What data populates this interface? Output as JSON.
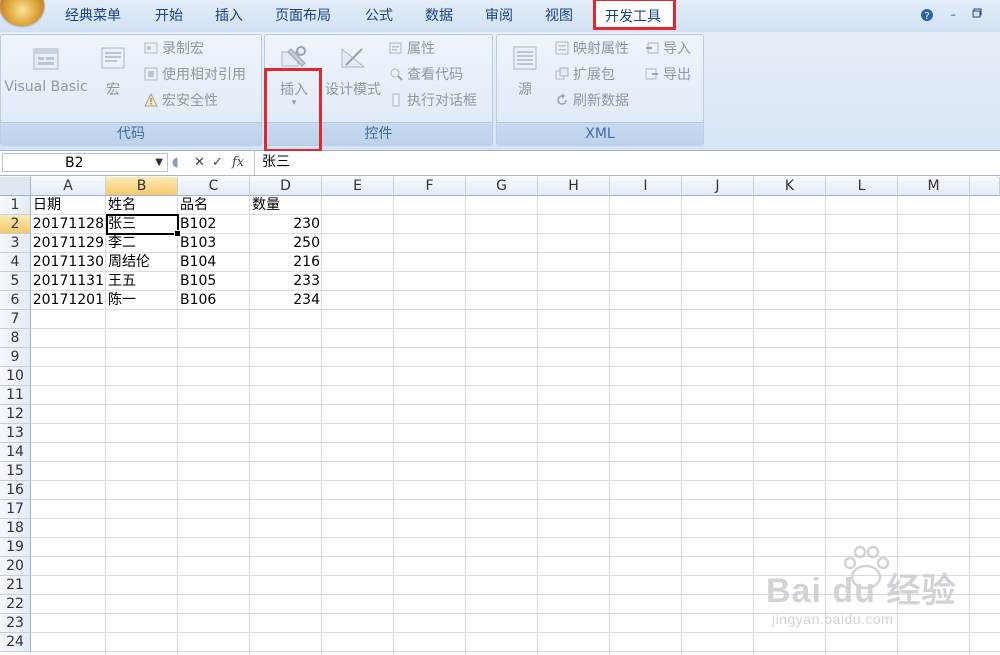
{
  "tabs": [
    {
      "label": "经典菜单"
    },
    {
      "label": "开始"
    },
    {
      "label": "插入"
    },
    {
      "label": "页面布局"
    },
    {
      "label": "公式"
    },
    {
      "label": "数据"
    },
    {
      "label": "审阅"
    },
    {
      "label": "视图"
    },
    {
      "label": "开发工具"
    }
  ],
  "ribbon": {
    "code": {
      "label": "代码",
      "visual_basic": "Visual Basic",
      "macro": "宏",
      "record_macro": "录制宏",
      "relative_ref": "使用相对引用",
      "macro_security": "宏安全性"
    },
    "controls": {
      "label": "控件",
      "insert": "插入",
      "design_mode": "设计模式",
      "properties": "属性",
      "view_code": "查看代码",
      "run_dialog": "执行对话框"
    },
    "xml": {
      "label": "XML",
      "source": "源",
      "map_properties": "映射属性",
      "expansion_packs": "扩展包",
      "refresh_data": "刷新数据",
      "import": "导入",
      "export": "导出"
    }
  },
  "formula_bar": {
    "name_box": "B2",
    "value": "张三"
  },
  "grid": {
    "columns": [
      "A",
      "B",
      "C",
      "D",
      "E",
      "F",
      "G",
      "H",
      "I",
      "J",
      "K",
      "L",
      "M"
    ],
    "rows": [
      "1",
      "2",
      "3",
      "4",
      "5",
      "6",
      "7",
      "8",
      "9",
      "10",
      "11",
      "12",
      "13",
      "14",
      "15",
      "16",
      "17",
      "18",
      "19",
      "20",
      "21",
      "22",
      "23",
      "24"
    ],
    "selected_cell": "B2",
    "header": [
      "日期",
      "姓名",
      "品名",
      "数量"
    ],
    "data": [
      [
        "20171128",
        "张三",
        "B102",
        "230"
      ],
      [
        "20171129",
        "李二",
        "B103",
        "250"
      ],
      [
        "20171130",
        "周结伦",
        "B104",
        "216"
      ],
      [
        "20171131",
        "王五",
        "B105",
        "233"
      ],
      [
        "20171201",
        "陈一",
        "B106",
        "234"
      ]
    ]
  },
  "watermark": {
    "line1": "Bai du 经验",
    "line2": "jingyan.baidu.com"
  },
  "colors": {
    "highlight": "#e0282e",
    "tab_text": "#15428b",
    "header_selected": "#f7c86a"
  }
}
